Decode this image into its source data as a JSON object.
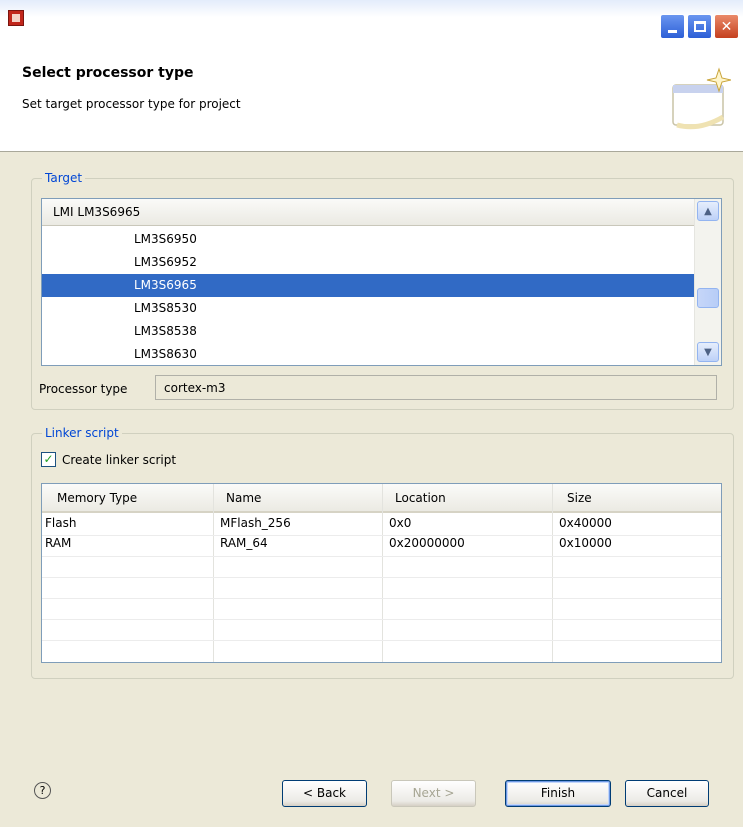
{
  "header": {
    "title": "Select processor type",
    "description": "Set target processor type for project"
  },
  "target": {
    "group_label": "Target",
    "list_header": "LMI LM3S6965",
    "items": [
      "LM3S6950",
      "LM3S6952",
      "LM3S6965",
      "LM3S8530",
      "LM3S8538",
      "LM3S8630"
    ],
    "selected_item": "LM3S6965"
  },
  "processor": {
    "label": "Processor type",
    "value": "cortex-m3"
  },
  "linker": {
    "group_label": "Linker script",
    "checkbox_label": "Create linker script",
    "checked": true,
    "columns": [
      "Memory Type",
      "Name",
      "Location",
      "Size"
    ],
    "rows": [
      [
        "Flash",
        "MFlash_256",
        "0x0",
        "0x40000"
      ],
      [
        "RAM",
        "RAM_64",
        "0x20000000",
        "0x10000"
      ]
    ]
  },
  "buttons": {
    "back": "< Back",
    "next": "Next >",
    "finish": "Finish",
    "cancel": "Cancel"
  },
  "icons": {
    "help": "?",
    "check": "✓"
  },
  "colors": {
    "selection": "#316ac5",
    "group_label": "#0046d5"
  }
}
